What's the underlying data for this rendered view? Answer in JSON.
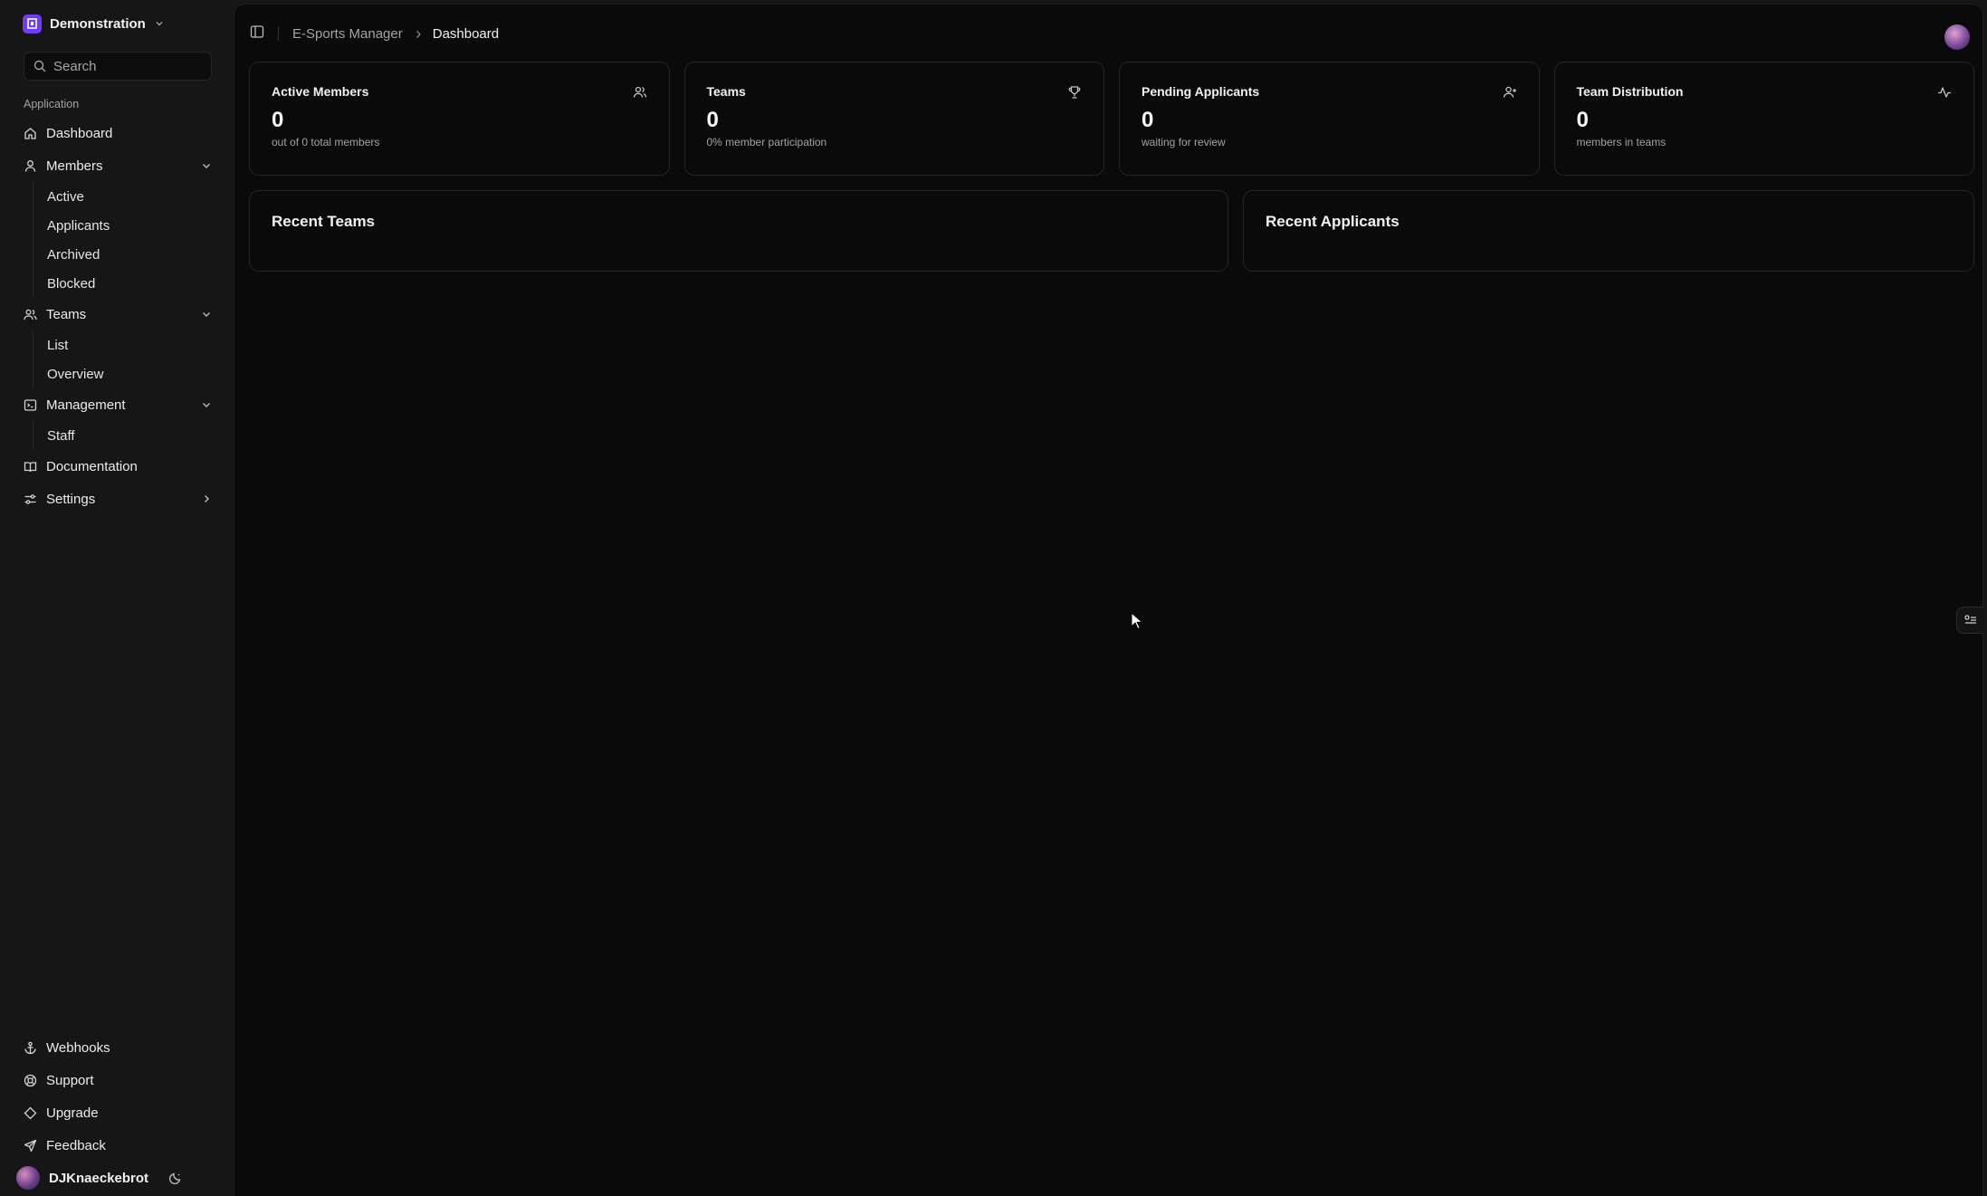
{
  "org": {
    "name": "Demonstration"
  },
  "search": {
    "placeholder": "Search"
  },
  "sidebar": {
    "group_label": "Application",
    "dashboard": "Dashboard",
    "members": {
      "label": "Members",
      "items": [
        "Active",
        "Applicants",
        "Archived",
        "Blocked"
      ]
    },
    "teams": {
      "label": "Teams",
      "items": [
        "List",
        "Overview"
      ]
    },
    "management": {
      "label": "Management",
      "items": [
        "Staff"
      ]
    },
    "documentation": "Documentation",
    "settings": "Settings",
    "bottom": {
      "webhooks": "Webhooks",
      "support": "Support",
      "upgrade": "Upgrade",
      "feedback": "Feedback"
    },
    "user": {
      "name": "DJKnaeckebrot"
    }
  },
  "breadcrumb": {
    "root": "E-Sports Manager",
    "current": "Dashboard"
  },
  "cards": {
    "active_members": {
      "title": "Active Members",
      "value": "0",
      "subtitle": "out of 0 total members",
      "icon": "users-icon"
    },
    "teams": {
      "title": "Teams",
      "value": "0",
      "subtitle": "0% member participation",
      "icon": "trophy-icon"
    },
    "pending_applicants": {
      "title": "Pending Applicants",
      "value": "0",
      "subtitle": "waiting for review",
      "icon": "user-plus-icon"
    },
    "team_distribution": {
      "title": "Team Distribution",
      "value": "0",
      "subtitle": "members in teams",
      "icon": "activity-icon"
    }
  },
  "panels": {
    "recent_teams": {
      "title": "Recent Teams"
    },
    "recent_applicants": {
      "title": "Recent Applicants"
    }
  }
}
